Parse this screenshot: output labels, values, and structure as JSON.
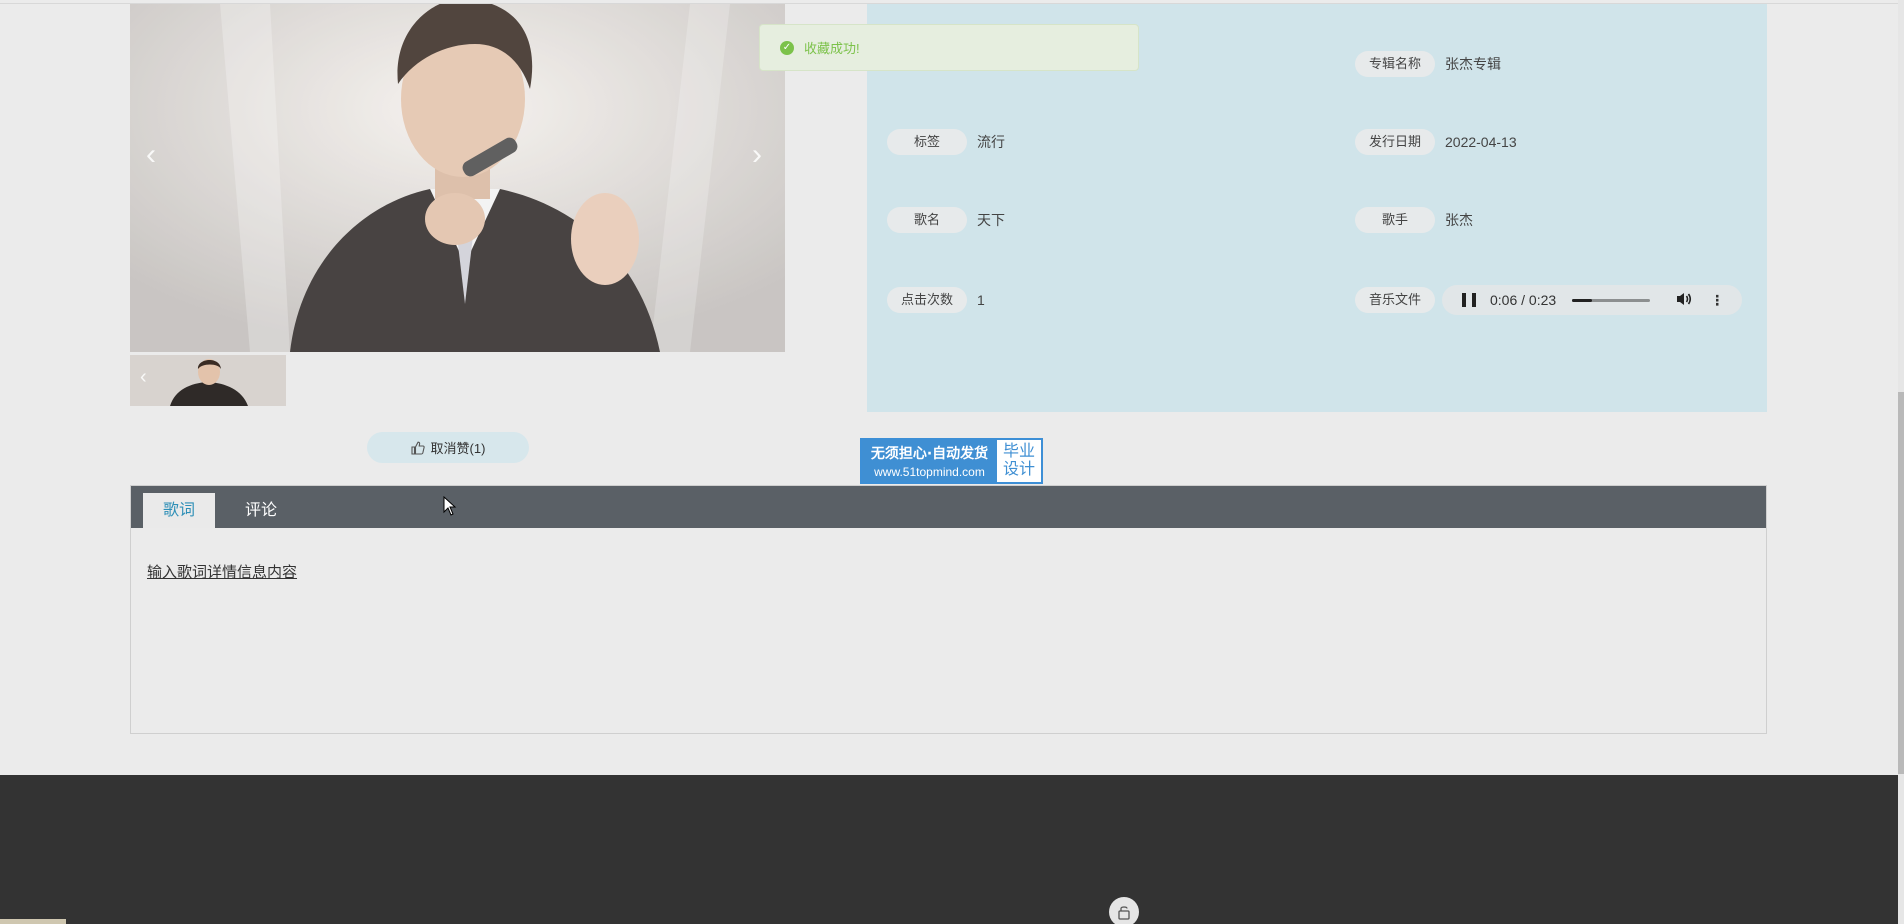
{
  "toast": {
    "message": "收藏成功!"
  },
  "gallery": {
    "prev_arrow": "‹",
    "next_arrow": "›",
    "thumb_prev_arrow": "‹"
  },
  "info": {
    "album_label": "专辑名称",
    "album_value": "张杰专辑",
    "tag_label": "标签",
    "tag_value": "流行",
    "date_label": "发行日期",
    "date_value": "2022-04-13",
    "song_label": "歌名",
    "song_value": "天下",
    "singer_label": "歌手",
    "singer_value": "张杰",
    "clicks_label": "点击次数",
    "clicks_value": "1",
    "file_label": "音乐文件"
  },
  "audio": {
    "time": "0:06 / 0:23",
    "progress": 0.26,
    "menu_icon": "⋮"
  },
  "like_button": {
    "label": "取消赞(1)"
  },
  "ad": {
    "line1": "无须担心·自动发货",
    "line2": "www.51topmind.com",
    "right_line1": "毕业",
    "right_line2": "设计"
  },
  "tabs": [
    {
      "label": "歌词"
    },
    {
      "label": "评论"
    }
  ],
  "lyrics": {
    "text": "输入歌词详情信息内容"
  },
  "colors": {
    "panel": "#d0e4ea",
    "tab_bar": "#5a6066",
    "accent": "#2e8fb7",
    "toast_text": "#7cc24a",
    "footer": "#333333"
  }
}
